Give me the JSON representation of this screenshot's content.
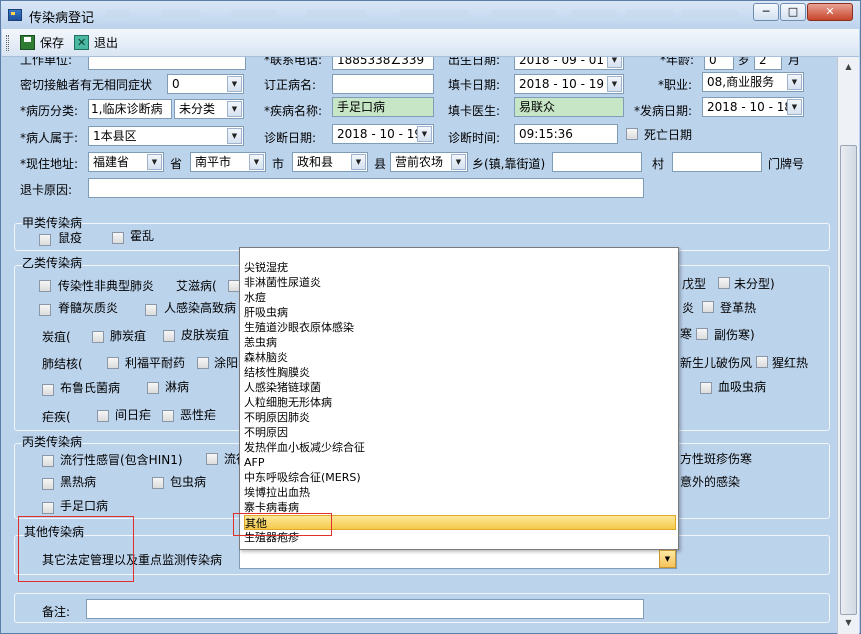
{
  "window": {
    "title": "传染病登记",
    "menu_blur_widths": [
      24,
      40,
      46,
      60,
      70,
      66,
      46,
      48,
      58,
      46
    ],
    "minimize": "─",
    "maximize": "□",
    "close": "✕"
  },
  "toolbar": {
    "save_label": "保存",
    "exit_label": "退出"
  },
  "form": {
    "work_unit_label": "工作单位:",
    "contact_phone_label": "*联系电话:",
    "contact_phone_value": "1885338∠339",
    "birth_date_label": "出生日期:",
    "birth_date_value": "2018 - 09 - 01",
    "age_label": "*年龄:",
    "age_value": "0",
    "age_month_value": "2",
    "month_label": "月",
    "close_contact_label": "密切接触者有无相同症状",
    "close_contact_value": "0",
    "revised_disease_label": "订正病名:",
    "revised_disease_value": "",
    "card_date_label": "填卡日期:",
    "card_date_value": "2018 - 10 - 19",
    "occupation_label": "*职业:",
    "occupation_value": "08,商业服务",
    "case_class_label": "*病历分类:",
    "case_class_value": "1,临床诊断病",
    "case_class_value2": "未分类",
    "disease_name_label": "*疾病名称:",
    "disease_name_value": "手足口病",
    "card_doctor_label": "填卡医生:",
    "card_doctor_value": "易联众",
    "onset_date_label": "*发病日期:",
    "onset_date_value": "2018 - 10 - 18",
    "belongs_label": "*病人属于:",
    "belongs_value": "1本县区",
    "diagnosis_date_label": "诊断日期:",
    "diagnosis_date_value": "2018 - 10 - 19",
    "diagnosis_time_label": "诊断时间:",
    "diagnosis_time_value": "09:15:36",
    "death_date_label": "死亡日期",
    "address_label": "*现住地址:",
    "province_value": "福建省",
    "province_label": "省",
    "city_value": "南平市",
    "city_label": "市",
    "county_value": "政和县",
    "county_label": "县",
    "township_value": "营前农场",
    "township_label": "乡(镇,靠街道)",
    "village_label": "村",
    "house_label": "门牌号",
    "reject_reason_label": "退卡原因:"
  },
  "class_a": {
    "title": "甲类传染病",
    "items": [
      "鼠疫",
      "霍乱"
    ]
  },
  "class_b": {
    "title": "乙类传染病",
    "row1": [
      "传染性非典型肺炎",
      "艾滋病("
    ],
    "row1_right": [
      "戊型",
      "未分型)"
    ],
    "row2": [
      "脊髓灰质炎",
      "人感染高致病"
    ],
    "row2_right": [
      "炎",
      "登革热"
    ],
    "row3_label": "炭疽(",
    "row3": [
      "肺炭疽",
      "皮肤炭疽"
    ],
    "row3_right": [
      "寒",
      "副伤寒)"
    ],
    "row4_label": "肺结核(",
    "row4": [
      "利福平耐药",
      "涂阳"
    ],
    "row4_right": [
      "新生儿破伤风",
      "猩红热"
    ],
    "row5": [
      "布鲁氏菌病",
      "淋病"
    ],
    "row5_right": [
      "血吸虫病"
    ],
    "row6_label": "疟疾(",
    "row6": [
      "间日疟",
      "恶性疟"
    ]
  },
  "class_c": {
    "title": "丙类传染病",
    "row1": [
      "流行性感冒(包含HIN1)",
      "流行"
    ],
    "row1_right": "方性斑疹伤寒",
    "row2": [
      "黑热病",
      "包虫病"
    ],
    "row2_right": "意外的感染",
    "row3": [
      "手足口病"
    ]
  },
  "other": {
    "title": "其他传染病",
    "combo_label": "其它法定管理以及重点监测传染病",
    "combo_value": ""
  },
  "remark_label": "备注:",
  "dropdown": {
    "items": [
      "尖锐湿疣",
      "非淋菌性尿道炎",
      "水痘",
      "肝吸虫病",
      "生殖道沙眼衣原体感染",
      "恙虫病",
      "森林脑炎",
      "结核性胸膜炎",
      "人感染猪链球菌",
      "人粒细胞无形体病",
      "不明原因肺炎",
      "不明原因",
      "发热伴血小板减少综合征",
      "AFP",
      "中东呼吸综合征(MERS)",
      "埃博拉出血热",
      "寨卡病毒病",
      "其他",
      "生殖器疱疹"
    ],
    "selected_index": 17
  }
}
